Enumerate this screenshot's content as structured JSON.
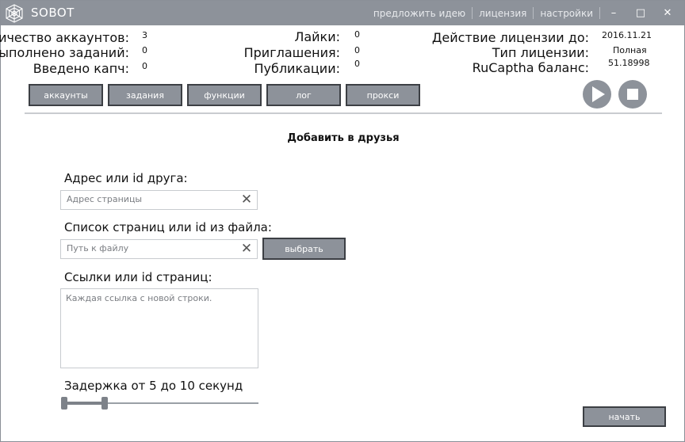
{
  "app": {
    "title": "SOBOT"
  },
  "topnav": {
    "suggest": "предложить идею",
    "license": "лицензия",
    "settings": "настройки",
    "minimize": "–",
    "maximize": "□",
    "close": "✕"
  },
  "stats": {
    "accounts_label": "Количество аккаунтов:",
    "accounts_value": "3",
    "tasks_label": "Выполнено заданий:",
    "tasks_value": "0",
    "captcha_label": "Введено капч:",
    "captcha_value": "0",
    "likes_label": "Лайки:",
    "likes_value": "0",
    "invites_label": "Приглашения:",
    "invites_value": "0",
    "posts_label": "Публикации:",
    "posts_value": "0",
    "license_until_label": "Действие лицензии до:",
    "license_until_value": "2016.11.21",
    "license_type_label": "Тип лицензии:",
    "license_type_value": "Полная",
    "rucaptcha_label": "RuCaptha баланс:",
    "rucaptcha_value": "51.18998"
  },
  "tabs": [
    "аккаунты",
    "задания",
    "функции",
    "лог",
    "прокси"
  ],
  "section": {
    "title": "Добавить в друзья"
  },
  "form": {
    "friend_label": "Адрес или id друга:",
    "friend_placeholder": "Адрес страницы",
    "file_label": "Список страниц или id из файла:",
    "file_placeholder": "Путь к файлу",
    "choose_button": "выбрать",
    "links_label": "Ссылки или id страниц:",
    "links_placeholder": "Каждая ссылка с новой строки.",
    "delay_label": "Задержка от 5 до 10 секунд",
    "delay_min": 5,
    "delay_max": 10,
    "start_button": "начать"
  },
  "colors": {
    "titlebar": "#8d929a",
    "button": "#8d929a",
    "button_border": "#3c3f44"
  }
}
